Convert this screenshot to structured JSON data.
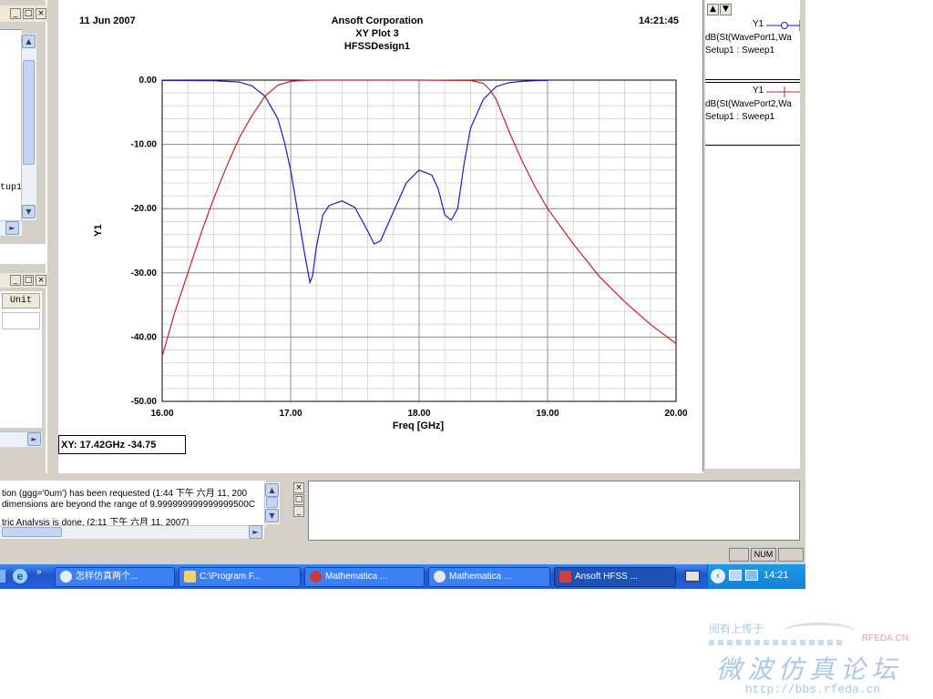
{
  "left_panel_top": {
    "item_text": "tup1"
  },
  "left_panel_bottom": {
    "col_header": "Unit"
  },
  "plot": {
    "date": "11 Jun 2007",
    "company": "Ansoft Corporation",
    "title": "XY Plot 3",
    "design": "HFSSDesign1",
    "time": "14:21:45",
    "readout": "XY: 17.42GHz -34.75"
  },
  "chart_data": {
    "type": "line",
    "xlabel": "Freq [GHz]",
    "ylabel": "Y1",
    "xlim": [
      16.0,
      20.0
    ],
    "ylim": [
      -50.0,
      0.0
    ],
    "xticks": [
      "16.00",
      "17.00",
      "18.00",
      "19.00",
      "20.00"
    ],
    "yticks": [
      "0.00",
      "-10.00",
      "-20.00",
      "-30.00",
      "-40.00",
      "-50.00"
    ],
    "grid": true,
    "legend_position": "right",
    "series": [
      {
        "name": "dB(St(WavePort1,Wa",
        "color": "#1a1acc",
        "x": [
          16.0,
          16.4,
          16.6,
          16.7,
          16.8,
          16.9,
          16.95,
          17.0,
          17.05,
          17.1,
          17.15,
          17.17,
          17.2,
          17.25,
          17.3,
          17.4,
          17.5,
          17.6,
          17.65,
          17.7,
          17.8,
          17.9,
          18.0,
          18.1,
          18.15,
          18.2,
          18.25,
          18.3,
          18.35,
          18.4,
          18.5,
          18.6,
          18.7,
          18.8,
          18.9,
          19.0
        ],
        "y": [
          -0.05,
          -0.1,
          -0.3,
          -0.9,
          -2.5,
          -6.0,
          -9.5,
          -14.0,
          -20.0,
          -26.0,
          -31.5,
          -30.5,
          -26.0,
          -21.0,
          -19.5,
          -18.8,
          -19.8,
          -23.5,
          -25.5,
          -25.0,
          -20.5,
          -16.0,
          -14.0,
          -14.8,
          -17.0,
          -21.0,
          -21.8,
          -20.0,
          -13.0,
          -7.5,
          -3.0,
          -1.0,
          -0.4,
          -0.2,
          -0.1,
          -0.05
        ]
      },
      {
        "name": "dB(St(WavePort2,Wa",
        "color": "#cc2020",
        "x": [
          16.0,
          16.1,
          16.2,
          16.3,
          16.4,
          16.5,
          16.6,
          16.7,
          16.8,
          16.9,
          17.0,
          17.1,
          17.2,
          17.5,
          18.0,
          18.4,
          18.5,
          18.55,
          18.6,
          18.7,
          18.8,
          18.9,
          19.0,
          19.2,
          19.4,
          19.6,
          19.8,
          20.0
        ],
        "y": [
          -43.0,
          -36.0,
          -30.0,
          -24.0,
          -18.5,
          -13.5,
          -9.0,
          -5.5,
          -2.5,
          -0.8,
          -0.2,
          -0.05,
          0.0,
          0.0,
          0.0,
          -0.05,
          -0.5,
          -1.5,
          -3.0,
          -8.0,
          -12.5,
          -16.5,
          -20.0,
          -25.5,
          -30.5,
          -34.5,
          -38.0,
          -41.0
        ]
      }
    ]
  },
  "legend": [
    {
      "y_label": "Y1",
      "trace": "dB(St(WavePort1,Wa",
      "setup": "Setup1 : Sweep1",
      "color": "#1a1acc"
    },
    {
      "y_label": "Y1",
      "trace": "dB(St(WavePort2,Wa",
      "setup": "Setup1 : Sweep1",
      "color": "#cc2020"
    }
  ],
  "messages": [
    "tion (ggg='0um') has been requested (1:44 下午  六月 11, 200",
    "dimensions are beyond the range of 9.999999999999999500C",
    "tric Analysis is done. (2:11 下午  六月 11, 2007)"
  ],
  "status_bar": {
    "num": "NUM"
  },
  "taskbar": {
    "items": [
      {
        "label": "怎样仿真两个..."
      },
      {
        "label": "C:\\Program F..."
      },
      {
        "label": "Mathematica ..."
      },
      {
        "label": "Mathematica ..."
      },
      {
        "label": "Ansoft HFSS ..."
      }
    ],
    "clock": "14:21"
  },
  "watermark": {
    "line1": "阅有上传于",
    "brand": "RFEDA.CN",
    "line2": "微波仿真论坛",
    "url": "http://bbs.rfeda.cn"
  }
}
